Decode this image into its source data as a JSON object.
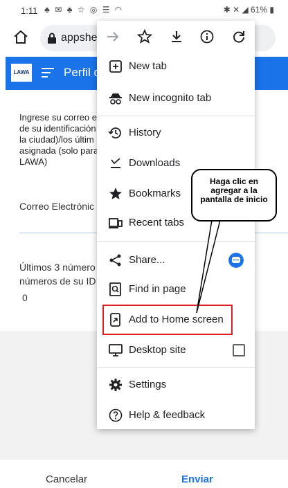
{
  "status_bar": {
    "time": "1:11",
    "battery": "61%"
  },
  "browser": {
    "url": "appshee"
  },
  "app": {
    "logo_text": "LAWA",
    "title": "Perfil d"
  },
  "form": {
    "instructions": [
      "Ingrese su correo e",
      "de su identificación",
      "la ciudad)/los últim",
      "asignada (solo para",
      "LAWA)"
    ],
    "email_label": "Correo Electrónic",
    "digits_label": [
      "Últimos 3 número",
      "números de su ID"
    ],
    "digits_value": "0"
  },
  "footer": {
    "cancel": "Cancelar",
    "send": "Enviar"
  },
  "menu": {
    "items": [
      {
        "label": "New tab",
        "icon": "new-tab-icon"
      },
      {
        "label": "New incognito tab",
        "icon": "incognito-icon"
      },
      {
        "label": "History",
        "icon": "history-icon"
      },
      {
        "label": "Downloads",
        "icon": "downloads-icon"
      },
      {
        "label": "Bookmarks",
        "icon": "star-icon"
      },
      {
        "label": "Recent tabs",
        "icon": "recent-tabs-icon"
      },
      {
        "label": "Share...",
        "icon": "share-icon"
      },
      {
        "label": "Find in page",
        "icon": "find-in-page-icon"
      },
      {
        "label": "Add to Home screen",
        "icon": "add-to-home-icon"
      },
      {
        "label": "Desktop site",
        "icon": "desktop-icon"
      },
      {
        "label": "Settings",
        "icon": "gear-icon"
      },
      {
        "label": "Help & feedback",
        "icon": "help-icon"
      }
    ]
  },
  "callout": {
    "lines": [
      "Haga clic en",
      "agregar a la",
      "pantalla de inicio"
    ]
  },
  "colors": {
    "accent": "#1a73e8",
    "highlight": "#e02020"
  }
}
